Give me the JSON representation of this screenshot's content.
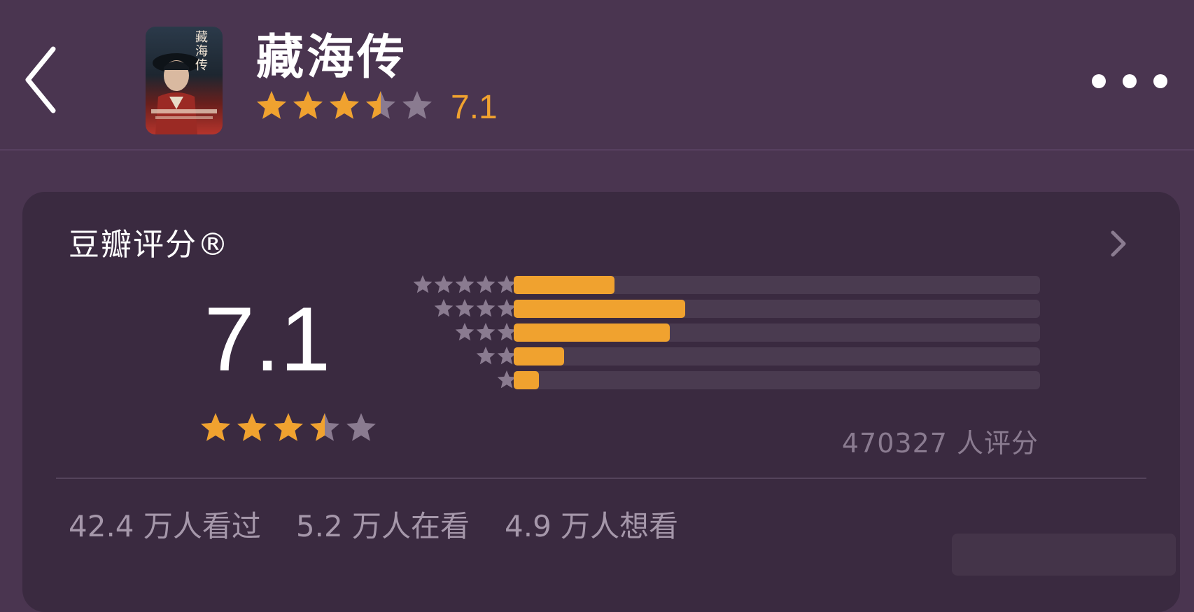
{
  "header": {
    "title": "藏海传",
    "score": "7.1",
    "stars_filled": 3.5,
    "poster_title": "藏海传"
  },
  "card": {
    "title": "豆瓣评分®",
    "score": "7.1",
    "stars_filled": 3.5,
    "rating_count": "470327 人评分",
    "distribution": [
      {
        "stars": 5,
        "fraction": 0.2
      },
      {
        "stars": 4,
        "fraction": 0.34
      },
      {
        "stars": 3,
        "fraction": 0.31
      },
      {
        "stars": 2,
        "fraction": 0.1
      },
      {
        "stars": 1,
        "fraction": 0.05
      }
    ],
    "stats": {
      "watched": "42.4 万人看过",
      "watching": "5.2 万人在看",
      "want": "4.9 万人想看"
    }
  },
  "colors": {
    "background": "#4a3550",
    "card": "#3a2a40",
    "accent": "#f0a22f",
    "star_empty": "#8a7b90"
  },
  "icons": {
    "back": "chevron-left-icon",
    "more": "more-dots-icon",
    "card_arrow": "chevron-right-icon"
  }
}
